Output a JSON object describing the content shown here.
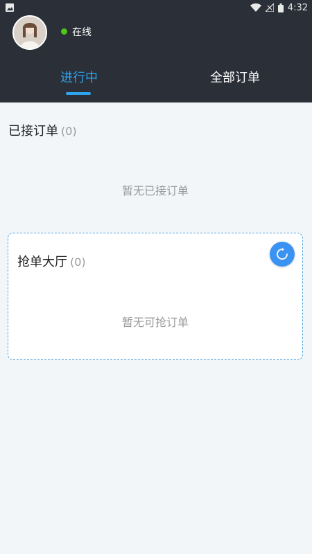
{
  "status_bar": {
    "time": "4:32"
  },
  "user": {
    "status": "在线"
  },
  "tabs": [
    {
      "label": "进行中",
      "active": true
    },
    {
      "label": "全部订单",
      "active": false
    }
  ],
  "accepted": {
    "title": "已接订单",
    "count": "(0)",
    "empty_text": "暂无已接订单"
  },
  "grab_hall": {
    "title": "抢单大厅",
    "count": "(0)",
    "empty_text": "暂无可抢订单"
  },
  "colors": {
    "header_bg": "#2b2f38",
    "accent": "#2ea4ef",
    "online": "#52c41a",
    "refresh": "#3a93f2",
    "page_bg": "#f2f6f9"
  }
}
